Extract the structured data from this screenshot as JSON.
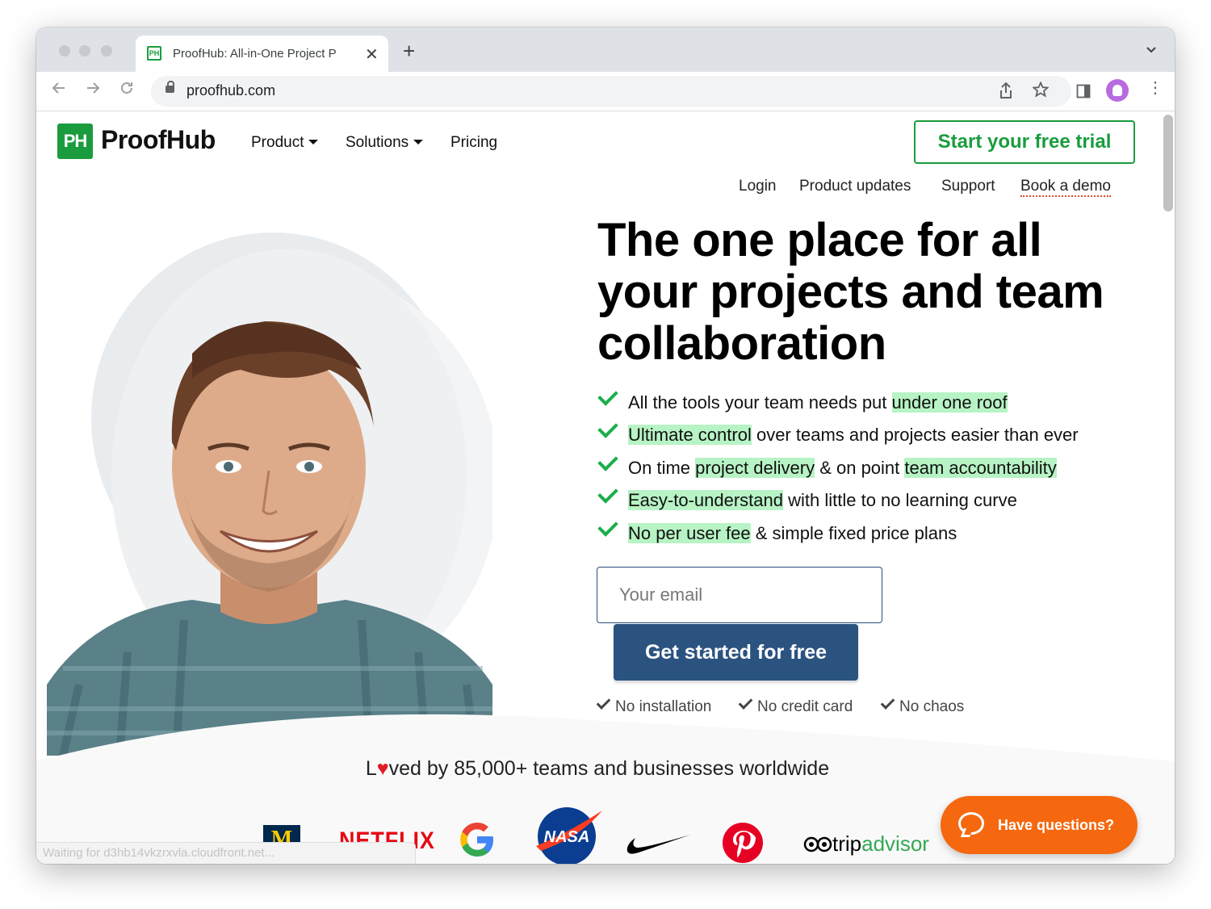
{
  "browser": {
    "tab_title": "ProofHub: All-in-One Project P",
    "tab_favicon": "PH",
    "url": "proofhub.com"
  },
  "header": {
    "logo_mark": "PH",
    "logo_text": "ProofHub",
    "nav": [
      {
        "label": "Product"
      },
      {
        "label": "Solutions"
      },
      {
        "label": "Pricing"
      }
    ],
    "trial_button": "Start your free trial",
    "secondary_links": [
      "Login",
      "Product updates",
      "Support",
      "Book a demo"
    ]
  },
  "hero": {
    "title": "The one place for all your projects and team collaboration",
    "features": [
      {
        "pre": "All the tools your team needs put ",
        "hl1": "under one roof",
        "mid": "",
        "hl2": "",
        "post": ""
      },
      {
        "pre": "",
        "hl1": "Ultimate control",
        "mid": " over teams and projects easier than ever",
        "hl2": "",
        "post": ""
      },
      {
        "pre": "On time ",
        "hl1": "project delivery",
        "mid": " & on point ",
        "hl2": "team accountability",
        "post": ""
      },
      {
        "pre": "",
        "hl1": "Easy-to-understand",
        "mid": " with little to no learning curve",
        "hl2": "",
        "post": ""
      },
      {
        "pre": "",
        "hl1": "No per user fee",
        "mid": " & simple fixed price plans",
        "hl2": "",
        "post": ""
      }
    ],
    "email_placeholder": "Your email",
    "cta": "Get started for free",
    "perks": [
      "No installation",
      "No credit card",
      "No chaos"
    ]
  },
  "social_proof": {
    "pre": "L",
    "heart": "♥",
    "post": "ved by 85,000+ teams and businesses worldwide",
    "logos": [
      "University of Michigan",
      "NETFLIX",
      "Google",
      "NASA",
      "Nike",
      "Pinterest",
      "tripadvisor"
    ],
    "michigan_letter": "M",
    "netflix_text": "NETFLIX",
    "nasa_text": "NASA",
    "trip_text1": "trip",
    "trip_text2": "advisor"
  },
  "status_bar": "Waiting for d3hb14vkzrxvla.cloudfront.net...",
  "chat": {
    "label": "Have questions?"
  },
  "colors": {
    "brand_green": "#1a9c3e",
    "highlight": "#b7f3c4",
    "cta_blue": "#2b5380",
    "chat_orange": "#f5680f"
  }
}
